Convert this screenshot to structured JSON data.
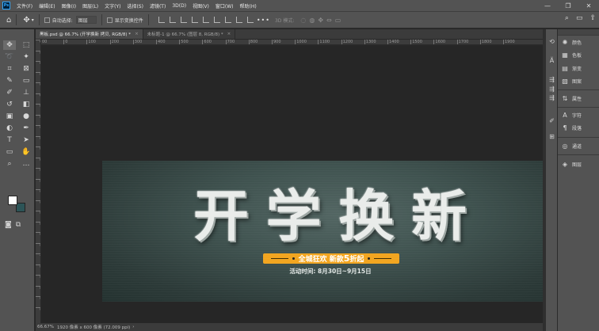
{
  "app": {
    "logo": "Ps"
  },
  "menubar": {
    "items": [
      "文件(F)",
      "编辑(E)",
      "图像(I)",
      "图层(L)",
      "文字(Y)",
      "选择(S)",
      "滤镜(T)",
      "3D(D)",
      "视图(V)",
      "窗口(W)",
      "帮助(H)"
    ],
    "window_controls": [
      "—",
      "❐",
      "✕"
    ]
  },
  "options": {
    "auto_select_label": "自动选择:",
    "auto_select_value": "图层",
    "show_transform_label": "显示变换控件",
    "mode_3d_label": "3D 模式:"
  },
  "tabs": [
    {
      "label": "黑板.psd @ 66.7% (开学换新 拷贝, RGB/8) *",
      "close": "×"
    },
    {
      "label": "未标题-1 @ 66.7% (图层 8, RGB/8) *",
      "close": "×"
    }
  ],
  "ruler": {
    "h_ticks": [
      "00",
      "0",
      "100",
      "200",
      "300",
      "400",
      "500",
      "600",
      "700",
      "800",
      "900",
      "1000",
      "1100",
      "1200",
      "1300",
      "1400",
      "1500",
      "1600",
      "1700",
      "1800",
      "1900"
    ],
    "v_ticks": [
      "1",
      "0",
      "1",
      "0",
      "0",
      "2",
      "0",
      "0",
      "3",
      "0",
      "0",
      "4",
      "0",
      "0",
      "5",
      "0",
      "0",
      "6",
      "0",
      "0",
      "7",
      "0",
      "0",
      "8",
      "0",
      "0"
    ]
  },
  "artwork": {
    "headline_chars": [
      "开",
      "学",
      "换",
      "新"
    ],
    "promo_part1": "全城狂欢 新款",
    "promo_num": "5",
    "promo_part2": "折起",
    "date_text": "活动时间: 8月30日~9月15日",
    "background_color": "#3f524f",
    "promo_color": "#f2a51f"
  },
  "status": {
    "zoom": "66.67%",
    "info": "1920 像素 x 600 像素 (72.009 ppi)",
    "chevron": "›"
  },
  "colors": {
    "foreground": "#ffffff",
    "background": "#2c5457"
  },
  "panels": {
    "dock": [
      {
        "icon": "✺",
        "label": "颜色"
      },
      {
        "icon": "▦",
        "label": "色板"
      },
      {
        "icon": "▤",
        "label": "渐变"
      },
      {
        "icon": "▧",
        "label": "图案"
      },
      {
        "icon": "⇅",
        "label": "属性"
      },
      {
        "icon": "A",
        "label": "字符"
      },
      {
        "icon": "¶",
        "label": "段落"
      },
      {
        "icon": "◎",
        "label": "通道"
      },
      {
        "icon": "◈",
        "label": "图层"
      }
    ]
  }
}
